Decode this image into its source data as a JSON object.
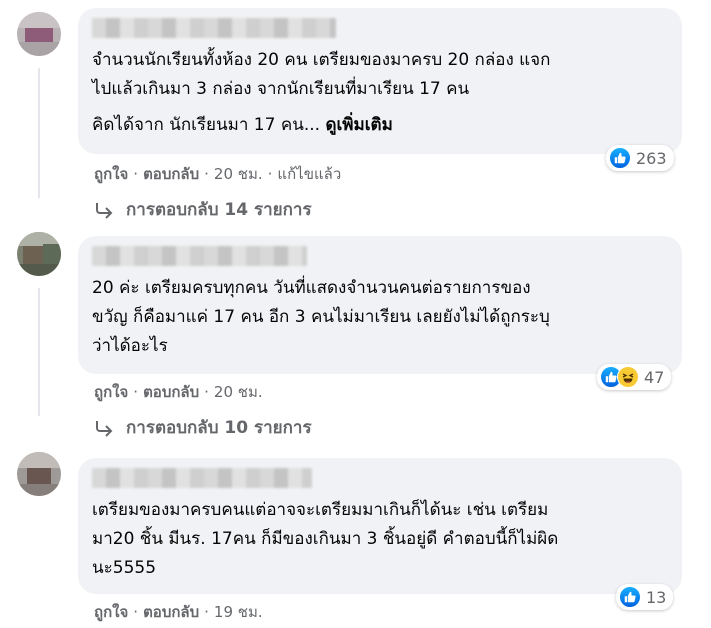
{
  "comments": [
    {
      "paragraphs": [
        "จำนวนนักเรียนทั้งห้อง 20 คน เตรียมของมาครบ 20 กล่อง แจก\nไปแล้วเกินมา 3 กล่อง จากนักเรียนที่มาเรียน 17 คน",
        "คิดได้จาก นักเรียนมา 17 คน..."
      ],
      "see_more": "ดูเพิ่มเติม",
      "reaction_count": "263",
      "reactions": [
        "like"
      ],
      "like": "ถูกใจ",
      "reply": "ตอบกลับ",
      "time": "20 ชม.",
      "edited": "แก้ไขแล้ว",
      "replies_label": "การตอบกลับ 14 รายการ"
    },
    {
      "paragraphs": [
        "20 ค่ะ เตรียมครบทุกคน วันที่แสดงจำนวนคนต่อรายการของ\nขวัญ ก็คือมาแค่ 17 คน อีก 3 คนไม่มาเรียน เลยยังไม่ได้ถูกระบุ\nว่าได้อะไร"
      ],
      "reaction_count": "47",
      "reactions": [
        "like",
        "haha"
      ],
      "like": "ถูกใจ",
      "reply": "ตอบกลับ",
      "time": "20 ชม.",
      "replies_label": "การตอบกลับ 10 รายการ"
    },
    {
      "paragraphs": [
        "เตรียมของมาครบคนแต่อาจจะเตรียมมาเกินก็ได้นะ เช่น เตรียม\nมา20 ชิ้น มีนร. 17คน ก็มีของเกินมา 3 ชิ้นอยู่ดี คำตอบนี้ก็ไม่ผิด\nนะ5555"
      ],
      "reaction_count": "13",
      "reactions": [
        "like"
      ],
      "like": "ถูกใจ",
      "reply": "ตอบกลับ",
      "time": "19 ชม."
    }
  ],
  "colors": {
    "bubble": "#f0f2f5",
    "secondary_text": "#65676b",
    "like_blue": "#1877f2",
    "haha_yellow": "#f7c932"
  }
}
